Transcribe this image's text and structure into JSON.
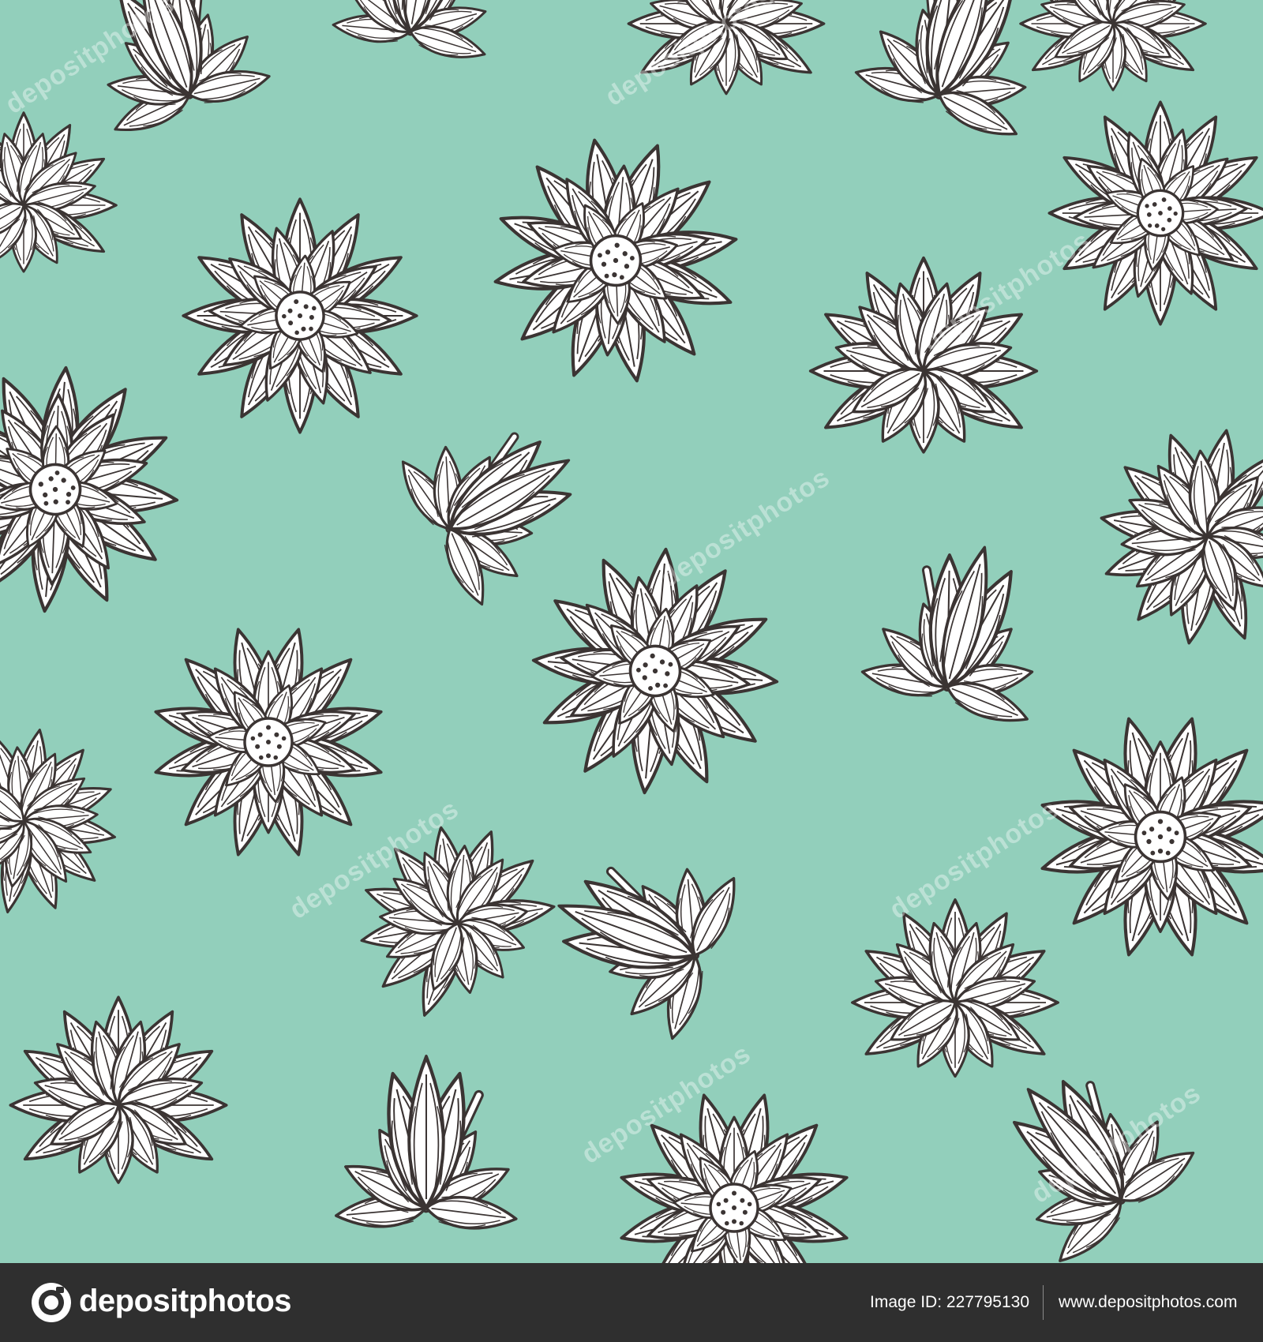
{
  "colors": {
    "background": "#92cfbb",
    "petal_fill": "#ffffff",
    "outline": "#3b3433",
    "footer_bg": "#2f2f2f",
    "footer_text": "#ffffff"
  },
  "pattern": {
    "motif": "hand-drawn lotus flowers",
    "watermark_text": "depositphotos"
  },
  "footer": {
    "brand_name": "depositphotos",
    "brand_logo_icon": "camera-aperture-icon",
    "image_id": "Image ID: 227795130",
    "site_url": "www.depositphotos.com"
  }
}
